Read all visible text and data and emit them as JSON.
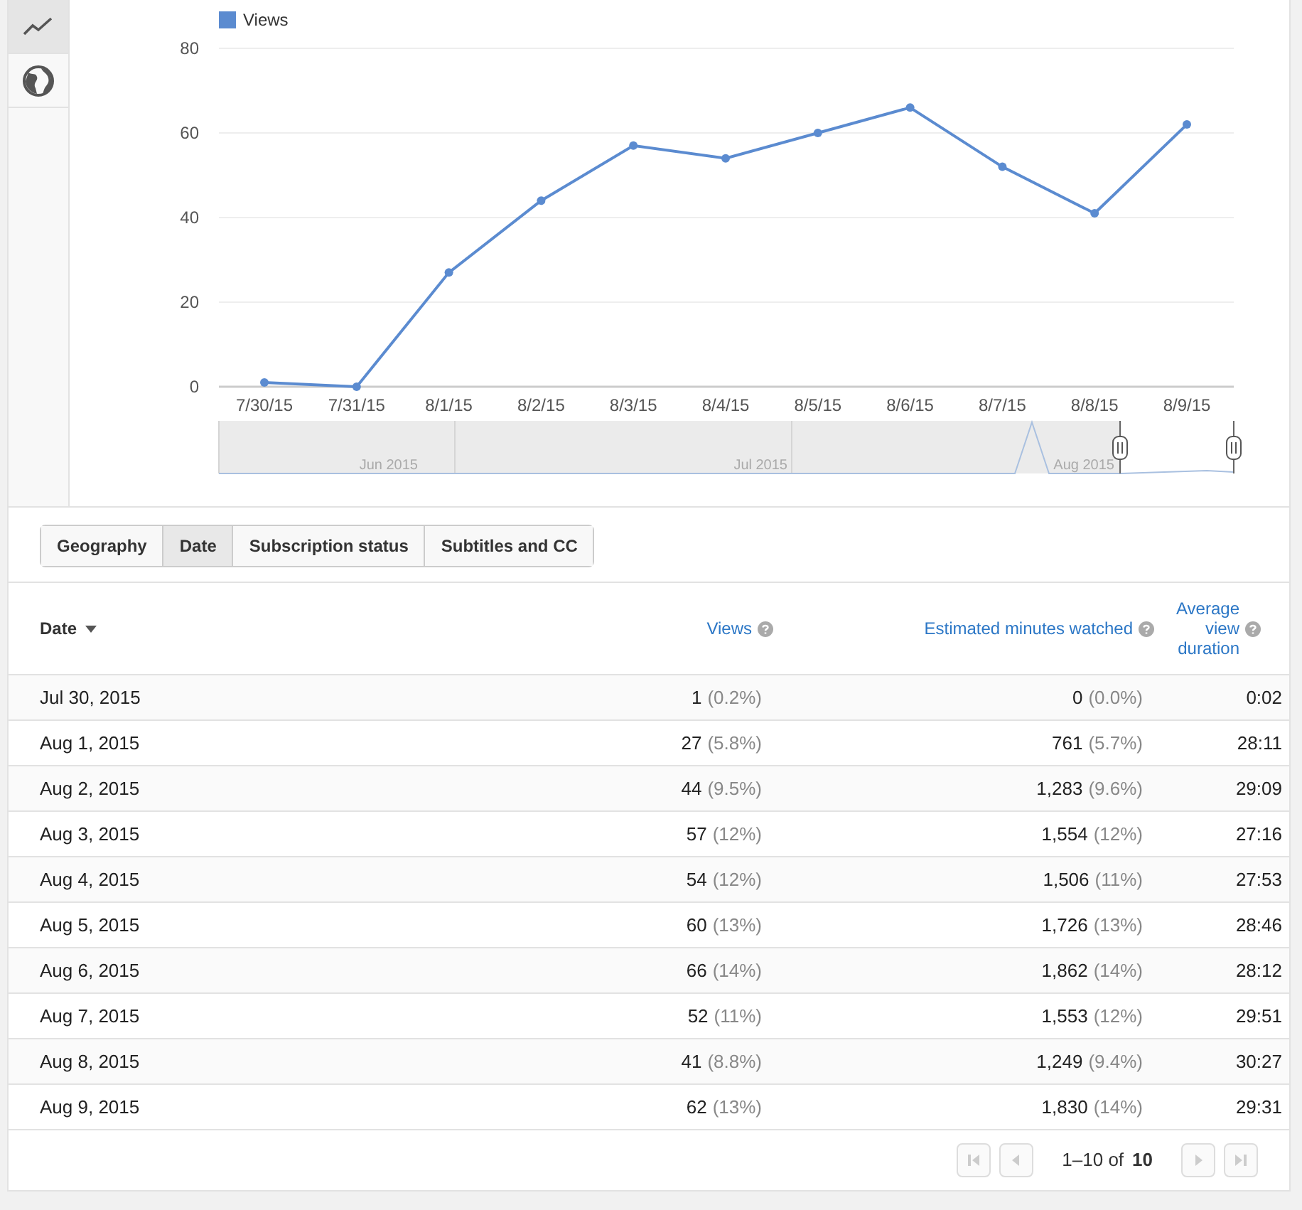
{
  "side_tabs": [
    {
      "kind": "line",
      "selected": true
    },
    {
      "kind": "map",
      "selected": false
    }
  ],
  "chart": {
    "chart_data": {
      "type": "line",
      "categories": [
        "7/30/15",
        "7/31/15",
        "8/1/15",
        "8/2/15",
        "8/3/15",
        "8/4/15",
        "8/5/15",
        "8/6/15",
        "8/7/15",
        "8/8/15",
        "8/9/15"
      ],
      "series": [
        {
          "name": "Views",
          "color": "#5b8bd0",
          "marker": true,
          "values": [
            1,
            0,
            27,
            44,
            57,
            54,
            60,
            66,
            52,
            41,
            62
          ]
        }
      ],
      "grid": true,
      "ylim": [
        0,
        80
      ],
      "yticks": [
        0,
        20,
        40,
        60,
        80
      ]
    },
    "navigator_labels": [
      "Jun 2015",
      "Jul 2015",
      "Aug 2015"
    ]
  },
  "dimension_tabs": [
    {
      "label": "Geography",
      "selected": false
    },
    {
      "label": "Date",
      "selected": true
    },
    {
      "label": "Subscription status",
      "selected": false
    },
    {
      "label": "Subtitles and CC",
      "selected": false
    }
  ],
  "table": {
    "columns": [
      {
        "label": "Date",
        "sorted": true
      },
      {
        "label": "Views",
        "sorted": false
      },
      {
        "label": "Estimated minutes watched",
        "sorted": false
      },
      {
        "label": "Average view duration",
        "sorted": false
      }
    ],
    "rows": [
      {
        "date": "Jul 30, 2015",
        "views": "1",
        "views_pct": "(0.2%)",
        "minutes": "0",
        "minutes_pct": "(0.0%)",
        "duration": "0:02"
      },
      {
        "date": "Aug 1, 2015",
        "views": "27",
        "views_pct": "(5.8%)",
        "minutes": "761",
        "minutes_pct": "(5.7%)",
        "duration": "28:11"
      },
      {
        "date": "Aug 2, 2015",
        "views": "44",
        "views_pct": "(9.5%)",
        "minutes": "1,283",
        "minutes_pct": "(9.6%)",
        "duration": "29:09"
      },
      {
        "date": "Aug 3, 2015",
        "views": "57",
        "views_pct": "(12%)",
        "minutes": "1,554",
        "minutes_pct": "(12%)",
        "duration": "27:16"
      },
      {
        "date": "Aug 4, 2015",
        "views": "54",
        "views_pct": "(12%)",
        "minutes": "1,506",
        "minutes_pct": "(11%)",
        "duration": "27:53"
      },
      {
        "date": "Aug 5, 2015",
        "views": "60",
        "views_pct": "(13%)",
        "minutes": "1,726",
        "minutes_pct": "(13%)",
        "duration": "28:46"
      },
      {
        "date": "Aug 6, 2015",
        "views": "66",
        "views_pct": "(14%)",
        "minutes": "1,862",
        "minutes_pct": "(14%)",
        "duration": "28:12"
      },
      {
        "date": "Aug 7, 2015",
        "views": "52",
        "views_pct": "(11%)",
        "minutes": "1,553",
        "minutes_pct": "(12%)",
        "duration": "29:51"
      },
      {
        "date": "Aug 8, 2015",
        "views": "41",
        "views_pct": "(8.8%)",
        "minutes": "1,249",
        "minutes_pct": "(9.4%)",
        "duration": "30:27"
      },
      {
        "date": "Aug 9, 2015",
        "views": "62",
        "views_pct": "(13%)",
        "minutes": "1,830",
        "minutes_pct": "(14%)",
        "duration": "29:31"
      }
    ]
  },
  "pagination": {
    "range": "1–10 of",
    "total": "10"
  }
}
